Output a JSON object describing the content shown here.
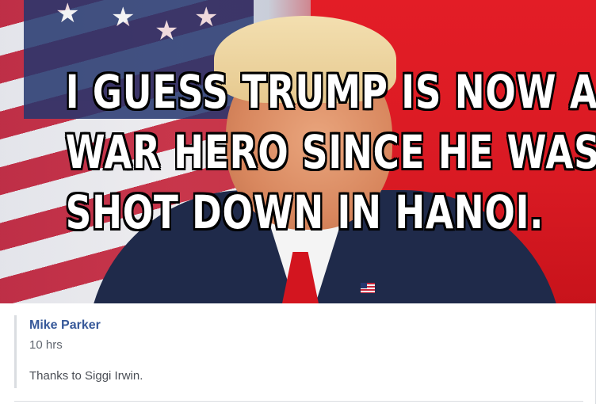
{
  "post": {
    "image": {
      "caption_lines": [
        "I GUESS TRUMP IS NOW A",
        "WAR HERO SINCE HE WAS",
        "SHOT DOWN IN HANOI."
      ]
    },
    "author": "Mike Parker",
    "timestamp": "10 hrs",
    "message": "Thanks to Siggi Irwin."
  },
  "colors": {
    "author_link": "#365899",
    "meta_text": "#616770",
    "body_text": "#4b4f56",
    "border": "#dadde1"
  }
}
